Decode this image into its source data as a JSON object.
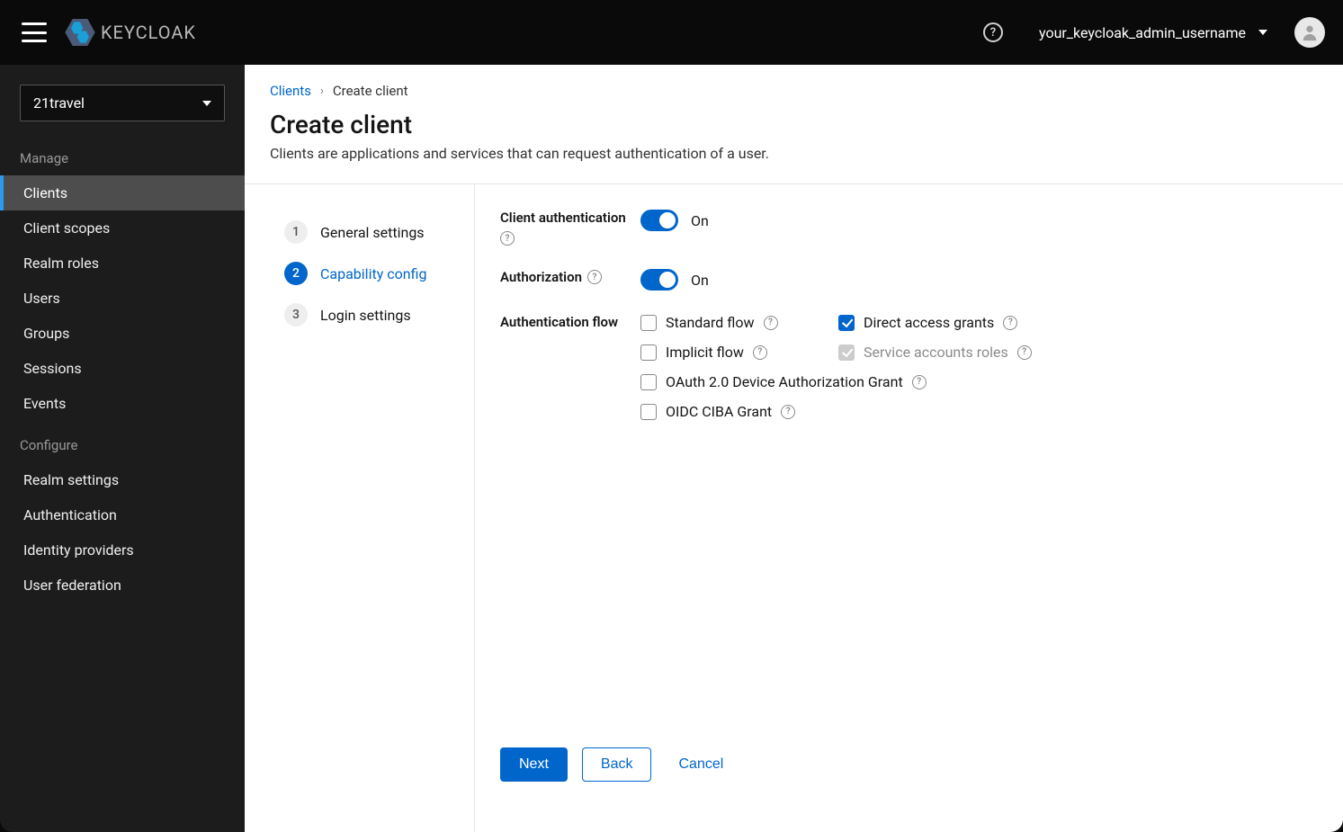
{
  "header": {
    "logo_text": "KEYCLOAK",
    "help_glyph": "?",
    "username": "your_keycloak_admin_username"
  },
  "sidebar": {
    "realm": "21travel",
    "groups": [
      {
        "label": "Manage",
        "items": [
          "Clients",
          "Client scopes",
          "Realm roles",
          "Users",
          "Groups",
          "Sessions",
          "Events"
        ],
        "active_index": 0
      },
      {
        "label": "Configure",
        "items": [
          "Realm settings",
          "Authentication",
          "Identity providers",
          "User federation"
        ],
        "active_index": -1
      }
    ]
  },
  "breadcrumb": {
    "parent": "Clients",
    "current": "Create client"
  },
  "page": {
    "title": "Create client",
    "description": "Clients are applications and services that can request authentication of a user."
  },
  "wizard": {
    "steps": [
      "General settings",
      "Capability config",
      "Login settings"
    ],
    "active_index": 1
  },
  "form": {
    "client_auth": {
      "label": "Client authentication",
      "value": "On"
    },
    "authorization": {
      "label": "Authorization",
      "value": "On"
    },
    "auth_flow_label": "Authentication flow",
    "flows": {
      "standard": {
        "label": "Standard flow",
        "checked": false,
        "disabled": false
      },
      "direct": {
        "label": "Direct access grants",
        "checked": true,
        "disabled": false
      },
      "implicit": {
        "label": "Implicit flow",
        "checked": false,
        "disabled": false
      },
      "service": {
        "label": "Service accounts roles",
        "checked": true,
        "disabled": true
      },
      "device": {
        "label": "OAuth 2.0 Device Authorization Grant",
        "checked": false,
        "disabled": false
      },
      "ciba": {
        "label": "OIDC CIBA Grant",
        "checked": false,
        "disabled": false
      }
    }
  },
  "actions": {
    "next": "Next",
    "back": "Back",
    "cancel": "Cancel"
  }
}
